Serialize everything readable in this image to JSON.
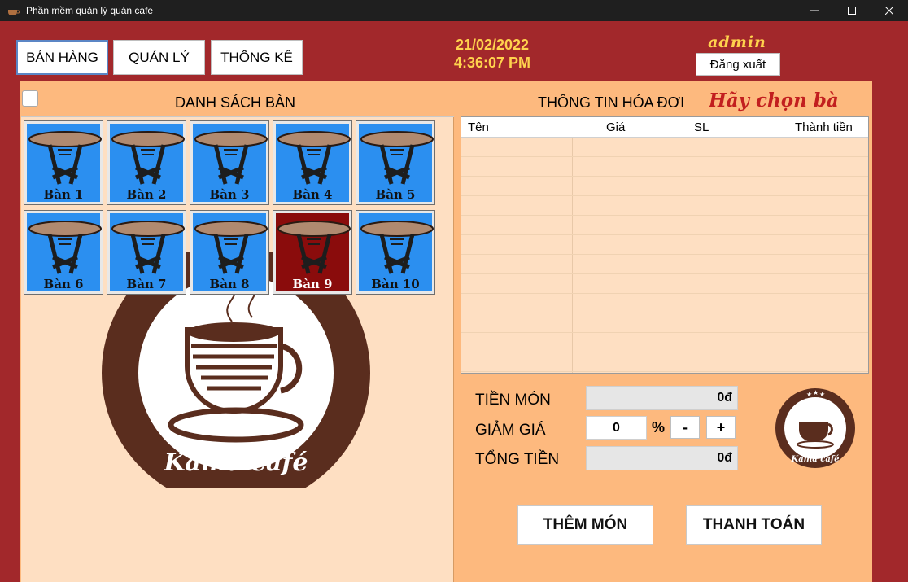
{
  "window": {
    "title": "Phần mềm quản lý quán cafe"
  },
  "nav": {
    "sales": "BÁN HÀNG",
    "manage": "QUẢN LÝ",
    "stats": "THỐNG KÊ"
  },
  "header": {
    "date": "21/02/2022",
    "time": "4:36:07 PM",
    "user": "admin",
    "logout": "Đăng xuất"
  },
  "tables_section": {
    "title": "DANH SÁCH BÀN",
    "tables": [
      {
        "label": "Bàn 1",
        "status": "empty"
      },
      {
        "label": "Bàn 2",
        "status": "empty"
      },
      {
        "label": "Bàn 3",
        "status": "empty"
      },
      {
        "label": "Bàn 4",
        "status": "empty"
      },
      {
        "label": "Bàn 5",
        "status": "empty"
      },
      {
        "label": "Bàn 6",
        "status": "empty"
      },
      {
        "label": "Bàn 7",
        "status": "empty"
      },
      {
        "label": "Bàn 8",
        "status": "empty"
      },
      {
        "label": "Bàn 9",
        "status": "occupied"
      },
      {
        "label": "Bàn 10",
        "status": "empty"
      }
    ]
  },
  "invoice": {
    "title": "THÔNG TIN HÓA ĐƠI",
    "hint": "Hãy chọn bà",
    "columns": [
      "Tên",
      "Giá",
      "SL",
      "Thành tiền"
    ]
  },
  "totals": {
    "subtotal_label": "TIỀN MÓN",
    "subtotal_value": "0đ",
    "discount_label": "GIẢM GIÁ",
    "discount_value": "0",
    "discount_unit": "%",
    "minus": "-",
    "plus": "+",
    "total_label": "TỔNG TIỀN",
    "total_value": "0đ"
  },
  "actions": {
    "add_item": "THÊM MÓN",
    "checkout": "THANH TOÁN"
  },
  "brand": {
    "logo_text": "Kama café"
  },
  "colors": {
    "background": "#a2282b",
    "panel": "#fdb97e",
    "table_empty": "#2b8ff0",
    "table_occupied": "#8a0c0c",
    "clock": "#ffd24d",
    "hint": "#c21f1f"
  }
}
